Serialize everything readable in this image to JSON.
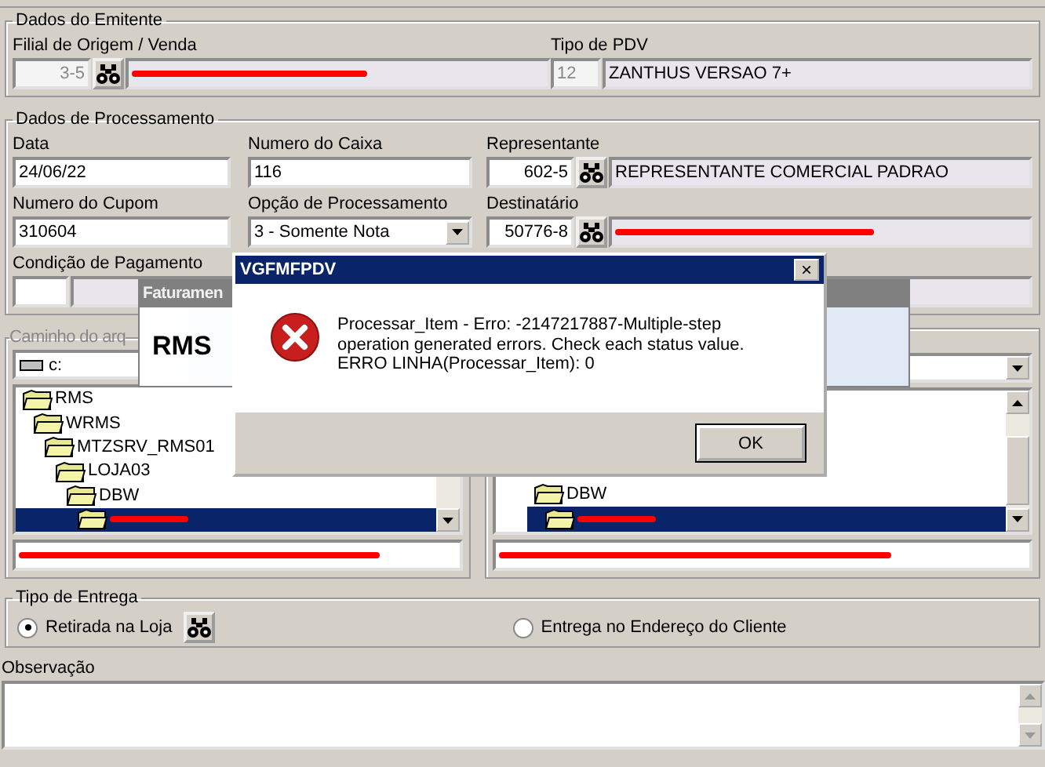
{
  "emitente": {
    "title": "Dados do Emitente",
    "filial_label": "Filial de Origem / Venda",
    "filial_code": "3-5",
    "filial_name_redacted": true,
    "pdv_label": "Tipo de PDV",
    "pdv_code": "12",
    "pdv_name": "ZANTHUS VERSAO 7+"
  },
  "processamento": {
    "title": "Dados de Processamento",
    "data_label": "Data",
    "data": "24/06/22",
    "caixa_label": "Numero do Caixa",
    "caixa": "116",
    "representante_label": "Representante",
    "representante_code": "602-5",
    "representante_name": "REPRESENTANTE COMERCIAL PADRAO",
    "cupom_label": "Numero do Cupom",
    "cupom": "310604",
    "opcao_label": "Opção de Processamento",
    "opcao": "3 - Somente Nota",
    "destinatario_label": "Destinatário",
    "destinatario_code": "50776-8",
    "destinatario_name_redacted": true,
    "pagamento_label": "Condição de Pagamento"
  },
  "caminho": {
    "title": "Caminho do arq",
    "left": {
      "drive": "c:",
      "tree": [
        {
          "label": "RMS",
          "selected": false,
          "children": [
            {
              "label": "WRMS",
              "selected": false,
              "children": [
                {
                  "label": "MTZSRV_RMS01",
                  "selected": false,
                  "children": [
                    {
                      "label": "LOJA03",
                      "selected": false,
                      "children": [
                        {
                          "label": "DBW",
                          "selected": false,
                          "children": [
                            {
                              "redacted": true,
                              "selected": true
                            }
                          ]
                        }
                      ]
                    }
                  ]
                }
              ]
            }
          ]
        }
      ],
      "path_redacted": true
    },
    "right": {
      "tree": [
        {
          "label": "DBW",
          "selected": false,
          "children": [
            {
              "redacted": true,
              "selected": true
            }
          ]
        }
      ],
      "path_redacted": true
    }
  },
  "entrega": {
    "title": "Tipo de Entrega",
    "options": [
      {
        "label": "Retirada na Loja",
        "selected": true
      },
      {
        "label": "Entrega no Endereço do Cliente",
        "selected": false
      }
    ]
  },
  "observacao": {
    "label": "Observação"
  },
  "splash": {
    "title": "Faturamen",
    "logo": "RMS"
  },
  "dialog": {
    "title": "VGFMFPDV",
    "close": "×",
    "message": "Processar_Item -  Erro: -2147217887-Multiple-step operation generated errors. Check each status value.  ERRO LINHA(Processar_Item): 0",
    "button": "OK"
  }
}
